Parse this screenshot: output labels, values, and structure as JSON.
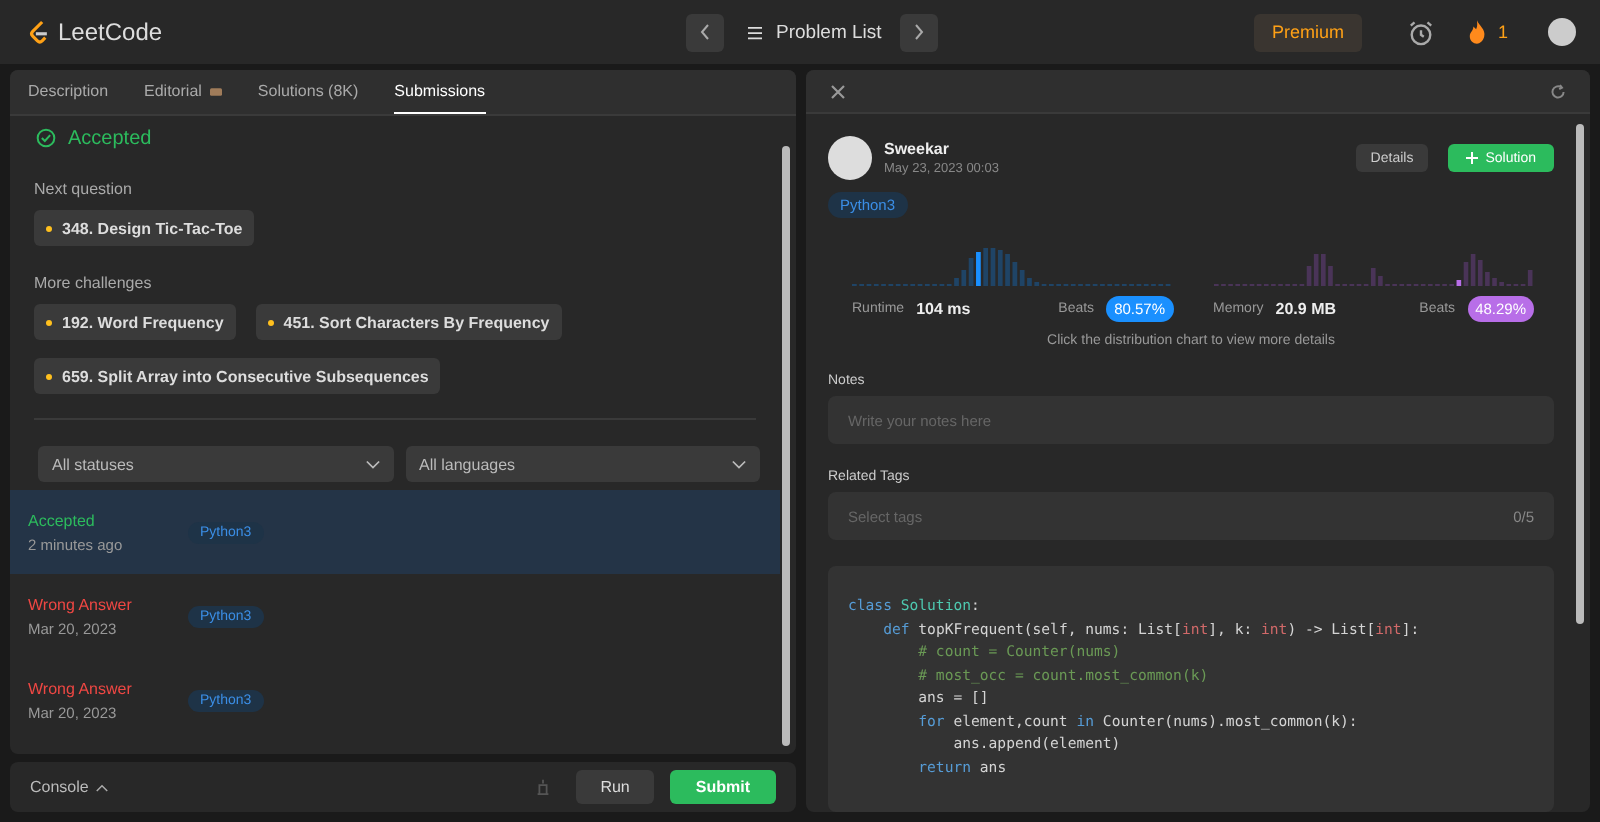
{
  "topbar": {
    "logo": "LeetCode",
    "problem_list": "Problem List",
    "premium": "Premium",
    "streak": "1"
  },
  "tabs": [
    {
      "label": "Description",
      "selected": false
    },
    {
      "label": "Editorial",
      "selected": false
    },
    {
      "label": "Solutions (8K)",
      "selected": false
    },
    {
      "label": "Submissions",
      "selected": true
    }
  ],
  "result": {
    "status": "Accepted",
    "next_heading": "Next question",
    "next": [
      {
        "label": "348. Design Tic-Tac-Toe",
        "color": "#ffc01e"
      }
    ],
    "more_heading": "More challenges",
    "more": [
      {
        "label": "192. Word Frequency",
        "color": "#ffc01e"
      },
      {
        "label": "451. Sort Characters By Frequency",
        "color": "#ffc01e"
      },
      {
        "label": "659. Split Array into Consecutive Subsequences",
        "color": "#ffc01e"
      }
    ]
  },
  "filters": [
    {
      "label": "All statuses"
    },
    {
      "label": "All languages"
    }
  ],
  "submissions": [
    {
      "status": "Accepted",
      "kind": "accepted",
      "time": "2 minutes ago",
      "language": "Python3",
      "selected": true
    },
    {
      "status": "Wrong Answer",
      "kind": "wrong",
      "time": "Mar 20, 2023",
      "language": "Python3",
      "selected": false
    },
    {
      "status": "Wrong Answer",
      "kind": "wrong",
      "time": "Mar 20, 2023",
      "language": "Python3",
      "selected": false
    }
  ],
  "console": {
    "label": "Console",
    "run": "Run",
    "submit": "Submit"
  },
  "detail": {
    "user": "Sweekar",
    "date": "May 23, 2023 00:03",
    "details": "Details",
    "solution": "Solution",
    "language": "Python3",
    "runtime_label": "Runtime",
    "runtime": "104 ms",
    "runtime_beats_label": "Beats",
    "runtime_beats": "80.57%",
    "memory_label": "Memory",
    "memory": "20.9 MB",
    "memory_beats_label": "Beats",
    "memory_beats": "48.29%",
    "caption": "Click the distribution chart to view more details",
    "notes_label": "Notes",
    "notes_placeholder": "Write your notes here",
    "tags_label": "Related Tags",
    "tags_placeholder": "Select tags",
    "tags_count": "0/5"
  },
  "code": [
    [
      {
        "text": "class ",
        "kind": "keyword"
      },
      {
        "text": "Solution",
        "kind": "class"
      },
      {
        "text": ":",
        "kind": "plain"
      }
    ],
    [
      {
        "text": "    def ",
        "kind": "keyword"
      },
      {
        "text": "topKFrequent(self, nums: List[",
        "kind": "plain"
      },
      {
        "text": "int",
        "kind": "type"
      },
      {
        "text": "], k: ",
        "kind": "plain"
      },
      {
        "text": "int",
        "kind": "type"
      },
      {
        "text": ") -> List[",
        "kind": "plain"
      },
      {
        "text": "int",
        "kind": "type"
      },
      {
        "text": "]:",
        "kind": "plain"
      }
    ],
    [
      {
        "text": "        # count = Counter(nums)",
        "kind": "comment"
      }
    ],
    [
      {
        "text": "        # most_occ = count.most_common(k)",
        "kind": "comment"
      }
    ],
    [
      {
        "text": "        ans = []",
        "kind": "plain"
      }
    ],
    [
      {
        "text": "        for ",
        "kind": "keyword"
      },
      {
        "text": "element,count ",
        "kind": "plain"
      },
      {
        "text": "in ",
        "kind": "keyword"
      },
      {
        "text": "Counter(nums).most_common(k):",
        "kind": "plain"
      }
    ],
    [
      {
        "text": "            ans.append(element)",
        "kind": "plain"
      }
    ],
    [
      {
        "text": "        return ",
        "kind": "keyword"
      },
      {
        "text": "ans",
        "kind": "plain"
      }
    ]
  ]
}
